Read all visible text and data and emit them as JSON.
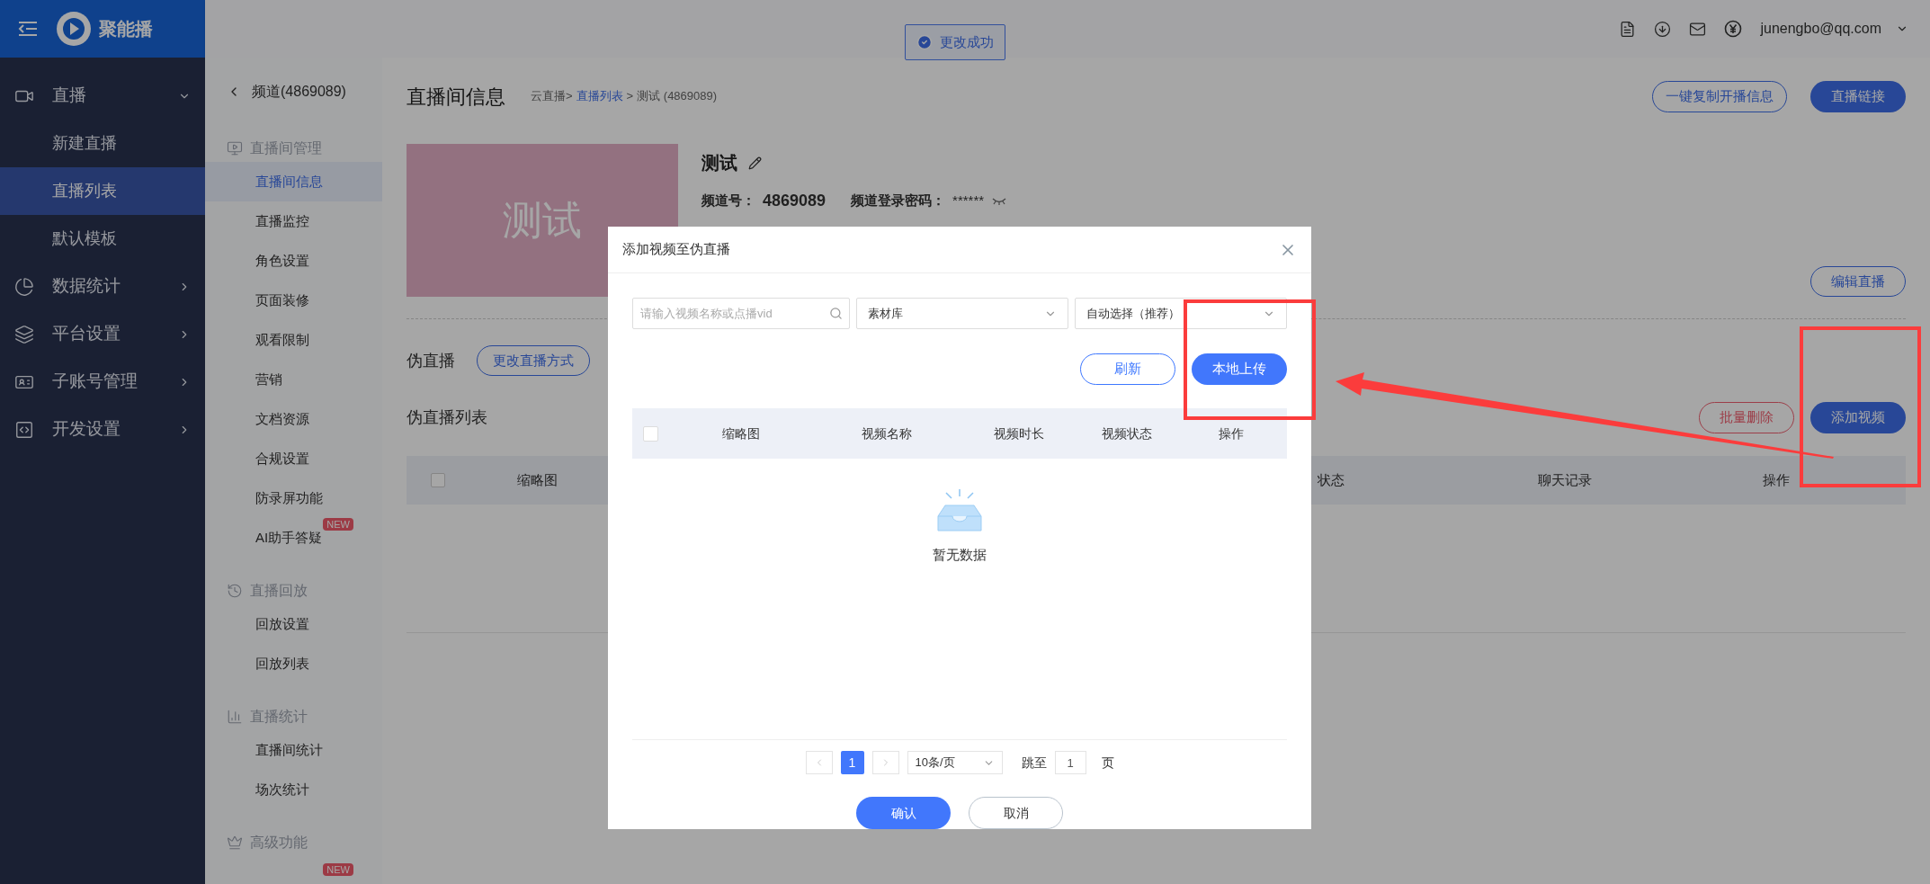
{
  "logo": {
    "name": "聚能播"
  },
  "header": {
    "user": "junengbo@qq.com"
  },
  "toast": {
    "text": "更改成功"
  },
  "sidebar": {
    "items": [
      {
        "label": "直播",
        "expanded": true,
        "children": [
          {
            "label": "新建直播",
            "selected": false
          },
          {
            "label": "直播列表",
            "selected": true
          },
          {
            "label": "默认模板",
            "selected": false
          }
        ]
      },
      {
        "label": "数据统计",
        "expanded": false
      },
      {
        "label": "平台设置",
        "expanded": false
      },
      {
        "label": "子账号管理",
        "expanded": false
      },
      {
        "label": "开发设置",
        "expanded": false
      }
    ]
  },
  "subnav": {
    "back": "频道(4869089)",
    "sections": [
      {
        "title": "直播间管理",
        "items": [
          {
            "label": "直播间信息",
            "selected": true
          },
          {
            "label": "直播监控",
            "selected": false
          },
          {
            "label": "角色设置",
            "selected": false
          },
          {
            "label": "页面装修",
            "selected": false
          },
          {
            "label": "观看限制",
            "selected": false
          },
          {
            "label": "营销",
            "selected": false
          },
          {
            "label": "文档资源",
            "selected": false
          },
          {
            "label": "合规设置",
            "selected": false
          },
          {
            "label": "防录屏功能",
            "selected": false
          },
          {
            "label": "AI助手答疑",
            "selected": false,
            "badge": "NEW"
          }
        ]
      },
      {
        "title": "直播回放",
        "items": [
          {
            "label": "回放设置",
            "selected": false
          },
          {
            "label": "回放列表",
            "selected": false
          }
        ]
      },
      {
        "title": "直播统计",
        "items": [
          {
            "label": "直播间统计",
            "selected": false
          },
          {
            "label": "场次统计",
            "selected": false
          }
        ]
      },
      {
        "title": "高级功能",
        "items": [
          {
            "selected": false,
            "badge": "NEW"
          }
        ]
      }
    ]
  },
  "page": {
    "title": "直播间信息",
    "breadcrumb": [
      {
        "text": "云直播>",
        "link": false
      },
      {
        "text": "直播列表",
        "link": true
      },
      {
        "text": ">",
        "link": false
      },
      {
        "text": "测试 (4869089)",
        "link": false
      }
    ],
    "actions": [
      "一键复制开播信息",
      "直播链接"
    ],
    "cover_text": "测试",
    "name": "测试",
    "channel_label": "频道号：",
    "channel_id": "4869089",
    "password_label": "频道登录密码：",
    "password": "******",
    "edit_button": "编辑直播",
    "mode_label": "伪直播",
    "mode_button": "更改直播方式",
    "list_title": "伪直播列表",
    "list_buttons": [
      "批量删除",
      "添加视频"
    ],
    "table": {
      "columns": [
        "缩略图",
        "",
        "状态",
        "聊天记录",
        "操作"
      ],
      "checked": false
    }
  },
  "dialog": {
    "title": "添加视频至伪直播",
    "search": {
      "placeholder": "请输入视频名称或点播vid"
    },
    "selects": [
      "素材库",
      "自动选择（推荐）"
    ],
    "buttons": [
      "刷新",
      "本地上传"
    ],
    "table": {
      "checked": false,
      "columns": [
        "缩略图",
        "视频名称",
        "视频时长",
        "视频状态",
        "操作"
      ]
    },
    "empty": "暂无数据",
    "pagination": {
      "pages": [
        {
          "label": "1",
          "selected": true
        }
      ],
      "page_size": "10条/页",
      "jump_label": "跳至",
      "jump_value": "1",
      "page_unit": "页"
    },
    "footer": [
      "确认",
      "取消"
    ]
  }
}
